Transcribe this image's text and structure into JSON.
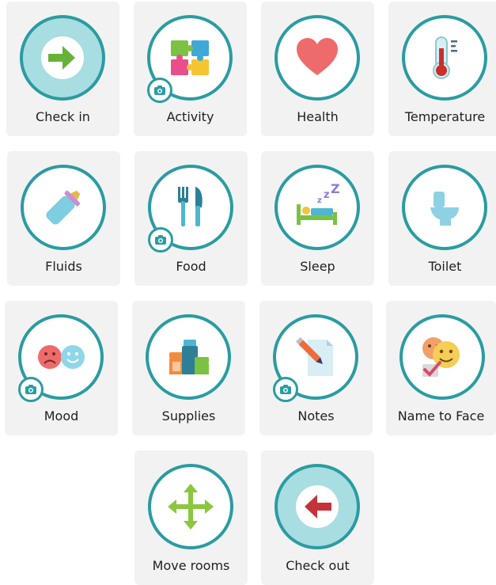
{
  "colors": {
    "tile_bg": "#f2f2f2",
    "ring": "#2a9ca1",
    "fill_light": "#a8dde2"
  },
  "tiles": [
    {
      "label": "Check in",
      "icon": "arrow-right-icon"
    },
    {
      "label": "Activity",
      "icon": "puzzle-icon",
      "camera": true
    },
    {
      "label": "Health",
      "icon": "heart-icon"
    },
    {
      "label": "Temperature",
      "icon": "thermometer-icon"
    },
    {
      "label": "Fluids",
      "icon": "baby-bottle-icon"
    },
    {
      "label": "Food",
      "icon": "fork-knife-icon",
      "camera": true
    },
    {
      "label": "Sleep",
      "icon": "bed-sleep-icon"
    },
    {
      "label": "Toilet",
      "icon": "toilet-icon"
    },
    {
      "label": "Mood",
      "icon": "faces-icon",
      "camera": true
    },
    {
      "label": "Supplies",
      "icon": "jars-icon"
    },
    {
      "label": "Notes",
      "icon": "note-pencil-icon",
      "camera": true
    },
    {
      "label": "Name to Face",
      "icon": "face-check-icon"
    },
    {
      "label": "Move rooms",
      "icon": "move-arrows-icon"
    },
    {
      "label": "Check out",
      "icon": "arrow-left-icon"
    }
  ]
}
